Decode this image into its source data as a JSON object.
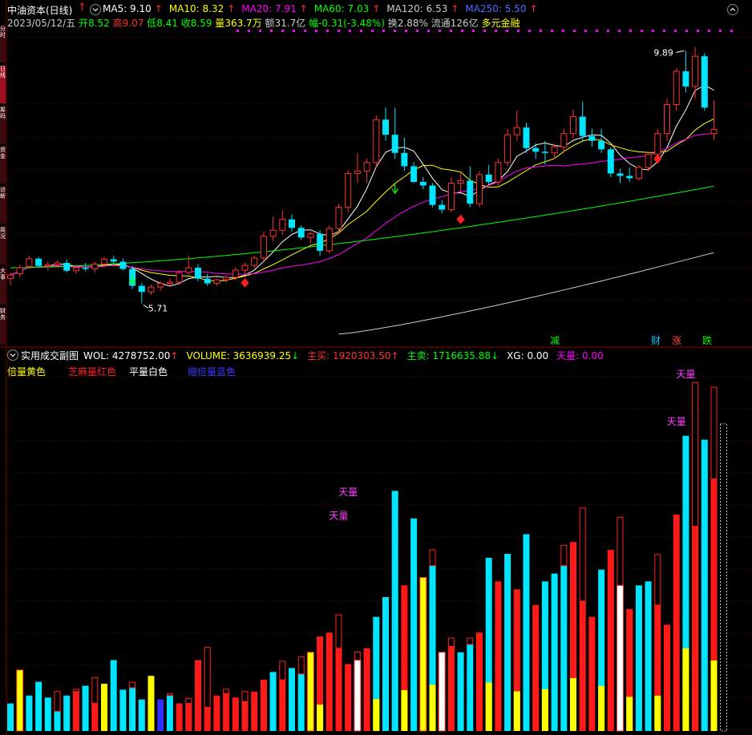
{
  "main_panel": {
    "stock_name": "中油资本(日线)",
    "ma_labels": [
      {
        "text": "MA5: 9.10",
        "color": "#ffffff"
      },
      {
        "text": "MA10: 8.32",
        "color": "#ffff00"
      },
      {
        "text": "MA20: 7.91",
        "color": "#ff00ff"
      },
      {
        "text": "MA60: 7.03",
        "color": "#00ff00"
      },
      {
        "text": "MA120: 6.53",
        "color": "#cccccc"
      },
      {
        "text": "MA250: 5.50",
        "color": "#4a6cff"
      }
    ],
    "info": {
      "date": "2023/05/12/五",
      "open_label": "开",
      "open": "8.52",
      "high_label": "高",
      "high": "9.07",
      "low_label": "低",
      "low": "8.41",
      "close_label": "收",
      "close": "8.59",
      "vol_label": "量",
      "vol": "363.7万",
      "amount_label": "额",
      "amount": "31.7亿",
      "change_label": "幅",
      "change": "-0.31(-3.48%)",
      "turnover_label": "换",
      "turnover": "2.88%",
      "float_label": "流通",
      "float": "126亿",
      "sector": "多元金融"
    },
    "high_mark": "9.89",
    "low_mark": "5.71",
    "markers": [
      {
        "text": "减",
        "color": "#00ff00"
      },
      {
        "text": "财",
        "color": "#00c8ff"
      },
      {
        "text": "涨",
        "color": "#ff4040"
      },
      {
        "text": "跌",
        "color": "#00ff00"
      }
    ]
  },
  "sub_panel": {
    "title": "实用成交副图",
    "stats": [
      {
        "text": "WOL: 4278752.00",
        "color": "#ffffff",
        "arrow": "↑",
        "arrow_color": "#ff3030"
      },
      {
        "text": "VOLUME: 3636939.25",
        "color": "#ffff00",
        "arrow": "↓",
        "arrow_color": "#00ff00"
      },
      {
        "text": "主买: 1920303.50",
        "color": "#ff3030",
        "arrow": "↑",
        "arrow_color": "#ff3030"
      },
      {
        "text": "主卖: 1716635.88",
        "color": "#00ff00",
        "arrow": "↓",
        "arrow_color": "#00ff00"
      },
      {
        "text": "XG: 0.00",
        "color": "#ffffff",
        "arrow": "",
        "arrow_color": "#ffffff"
      },
      {
        "text": "天量: 0.00",
        "color": "#ff00ff",
        "arrow": "",
        "arrow_color": "#ffffff"
      }
    ],
    "legend": [
      {
        "text": "倍量黄色",
        "color": "#ffff00"
      },
      {
        "text": "芝麻量红色",
        "color": "#ff2020"
      },
      {
        "text": "平量白色",
        "color": "#ffffff"
      },
      {
        "text": "缩倍量蓝色",
        "color": "#3a3aff"
      }
    ],
    "tianliang_label": "天量"
  },
  "side_tabs": [
    "分时",
    "日线",
    "筹码",
    "资金",
    "诊断",
    "简况",
    "大事",
    "财务"
  ],
  "chart_data": {
    "type": "candlestick",
    "price_range": [
      5.0,
      10.2
    ],
    "days": 76,
    "candles": [
      {
        "o": 6.12,
        "h": 6.22,
        "l": 6.0,
        "c": 6.18
      },
      {
        "o": 6.2,
        "h": 6.35,
        "l": 6.15,
        "c": 6.3
      },
      {
        "o": 6.32,
        "h": 6.5,
        "l": 6.28,
        "c": 6.45
      },
      {
        "o": 6.45,
        "h": 6.48,
        "l": 6.3,
        "c": 6.33
      },
      {
        "o": 6.33,
        "h": 6.4,
        "l": 6.25,
        "c": 6.35
      },
      {
        "o": 6.35,
        "h": 6.42,
        "l": 6.3,
        "c": 6.38
      },
      {
        "o": 6.38,
        "h": 6.44,
        "l": 6.22,
        "c": 6.25
      },
      {
        "o": 6.25,
        "h": 6.35,
        "l": 6.2,
        "c": 6.3
      },
      {
        "o": 6.3,
        "h": 6.38,
        "l": 6.24,
        "c": 6.28
      },
      {
        "o": 6.28,
        "h": 6.4,
        "l": 6.22,
        "c": 6.36
      },
      {
        "o": 6.36,
        "h": 6.48,
        "l": 6.3,
        "c": 6.44
      },
      {
        "o": 6.44,
        "h": 6.5,
        "l": 6.36,
        "c": 6.4
      },
      {
        "o": 6.4,
        "h": 6.45,
        "l": 6.25,
        "c": 6.28
      },
      {
        "o": 6.28,
        "h": 6.33,
        "l": 5.95,
        "c": 6.0
      },
      {
        "o": 6.0,
        "h": 6.05,
        "l": 5.71,
        "c": 5.9
      },
      {
        "o": 5.9,
        "h": 6.02,
        "l": 5.85,
        "c": 5.98
      },
      {
        "o": 5.98,
        "h": 6.08,
        "l": 5.92,
        "c": 6.04
      },
      {
        "o": 6.04,
        "h": 6.12,
        "l": 5.98,
        "c": 6.06
      },
      {
        "o": 6.06,
        "h": 6.26,
        "l": 6.02,
        "c": 6.22
      },
      {
        "o": 6.22,
        "h": 6.5,
        "l": 6.18,
        "c": 6.3
      },
      {
        "o": 6.3,
        "h": 6.36,
        "l": 6.08,
        "c": 6.12
      },
      {
        "o": 6.12,
        "h": 6.2,
        "l": 6.0,
        "c": 6.04
      },
      {
        "o": 6.04,
        "h": 6.12,
        "l": 6.0,
        "c": 6.1
      },
      {
        "o": 6.1,
        "h": 6.18,
        "l": 6.05,
        "c": 6.14
      },
      {
        "o": 6.14,
        "h": 6.3,
        "l": 6.1,
        "c": 6.26
      },
      {
        "o": 6.26,
        "h": 6.38,
        "l": 6.2,
        "c": 6.34
      },
      {
        "o": 6.34,
        "h": 6.5,
        "l": 6.3,
        "c": 6.46
      },
      {
        "o": 6.46,
        "h": 6.9,
        "l": 6.4,
        "c": 6.82
      },
      {
        "o": 6.82,
        "h": 7.15,
        "l": 6.74,
        "c": 6.92
      },
      {
        "o": 6.92,
        "h": 7.25,
        "l": 6.85,
        "c": 7.1
      },
      {
        "o": 7.1,
        "h": 7.18,
        "l": 6.9,
        "c": 6.96
      },
      {
        "o": 6.96,
        "h": 7.0,
        "l": 6.76,
        "c": 6.8
      },
      {
        "o": 6.8,
        "h": 6.9,
        "l": 6.7,
        "c": 6.86
      },
      {
        "o": 6.86,
        "h": 6.92,
        "l": 6.5,
        "c": 6.58
      },
      {
        "o": 6.58,
        "h": 7.0,
        "l": 6.54,
        "c": 6.95
      },
      {
        "o": 6.95,
        "h": 7.36,
        "l": 6.88,
        "c": 7.3
      },
      {
        "o": 7.3,
        "h": 7.92,
        "l": 7.22,
        "c": 7.86
      },
      {
        "o": 7.86,
        "h": 8.2,
        "l": 7.7,
        "c": 7.9
      },
      {
        "o": 7.9,
        "h": 8.1,
        "l": 7.7,
        "c": 8.04
      },
      {
        "o": 8.04,
        "h": 8.82,
        "l": 7.96,
        "c": 8.75
      },
      {
        "o": 8.75,
        "h": 8.95,
        "l": 8.4,
        "c": 8.5
      },
      {
        "o": 8.5,
        "h": 8.95,
        "l": 8.1,
        "c": 8.2
      },
      {
        "o": 8.2,
        "h": 8.45,
        "l": 7.9,
        "c": 7.98
      },
      {
        "o": 7.98,
        "h": 8.05,
        "l": 7.7,
        "c": 7.72
      },
      {
        "o": 7.72,
        "h": 7.8,
        "l": 7.6,
        "c": 7.66
      },
      {
        "o": 7.66,
        "h": 7.7,
        "l": 7.3,
        "c": 7.34
      },
      {
        "o": 7.34,
        "h": 7.42,
        "l": 7.2,
        "c": 7.26
      },
      {
        "o": 7.26,
        "h": 7.8,
        "l": 7.22,
        "c": 7.7
      },
      {
        "o": 7.7,
        "h": 7.86,
        "l": 7.55,
        "c": 7.74
      },
      {
        "o": 7.74,
        "h": 7.98,
        "l": 7.3,
        "c": 7.36
      },
      {
        "o": 7.36,
        "h": 7.9,
        "l": 7.3,
        "c": 7.84
      },
      {
        "o": 7.84,
        "h": 8.0,
        "l": 7.68,
        "c": 7.72
      },
      {
        "o": 7.72,
        "h": 8.1,
        "l": 7.66,
        "c": 8.04
      },
      {
        "o": 8.04,
        "h": 8.6,
        "l": 7.98,
        "c": 8.5
      },
      {
        "o": 8.5,
        "h": 8.9,
        "l": 8.4,
        "c": 8.62
      },
      {
        "o": 8.62,
        "h": 8.7,
        "l": 8.2,
        "c": 8.28
      },
      {
        "o": 8.28,
        "h": 8.36,
        "l": 8.1,
        "c": 8.22
      },
      {
        "o": 8.22,
        "h": 8.4,
        "l": 8.0,
        "c": 8.2
      },
      {
        "o": 8.2,
        "h": 8.35,
        "l": 8.1,
        "c": 8.3
      },
      {
        "o": 8.3,
        "h": 8.6,
        "l": 8.2,
        "c": 8.52
      },
      {
        "o": 8.52,
        "h": 8.92,
        "l": 8.44,
        "c": 8.8
      },
      {
        "o": 8.8,
        "h": 9.05,
        "l": 8.4,
        "c": 8.48
      },
      {
        "o": 8.48,
        "h": 8.6,
        "l": 8.3,
        "c": 8.4
      },
      {
        "o": 8.4,
        "h": 8.6,
        "l": 8.2,
        "c": 8.26
      },
      {
        "o": 8.26,
        "h": 8.3,
        "l": 7.8,
        "c": 7.86
      },
      {
        "o": 7.86,
        "h": 7.94,
        "l": 7.7,
        "c": 7.82
      },
      {
        "o": 7.82,
        "h": 7.96,
        "l": 7.72,
        "c": 7.78
      },
      {
        "o": 7.78,
        "h": 8.0,
        "l": 7.74,
        "c": 7.96
      },
      {
        "o": 7.96,
        "h": 8.22,
        "l": 7.9,
        "c": 8.18
      },
      {
        "o": 8.18,
        "h": 8.6,
        "l": 8.1,
        "c": 8.52
      },
      {
        "o": 8.52,
        "h": 9.1,
        "l": 8.4,
        "c": 9.0
      },
      {
        "o": 9.0,
        "h": 9.6,
        "l": 8.9,
        "c": 9.55
      },
      {
        "o": 9.55,
        "h": 9.89,
        "l": 9.2,
        "c": 9.3
      },
      {
        "o": 9.3,
        "h": 9.95,
        "l": 9.1,
        "c": 9.8
      },
      {
        "o": 9.8,
        "h": 9.85,
        "l": 8.9,
        "c": 8.95
      },
      {
        "o": 8.52,
        "h": 9.07,
        "l": 8.41,
        "c": 8.59
      }
    ],
    "volume_range": [
      0,
      9000000
    ],
    "volumes": [
      700000,
      1550000,
      900000,
      1250000,
      850000,
      500000,
      900000,
      1000000,
      1150000,
      700000,
      1200000,
      1800000,
      1050000,
      1100000,
      800000,
      1400000,
      800000,
      900000,
      700000,
      700000,
      1800000,
      600000,
      900000,
      950000,
      850000,
      750000,
      1000000,
      1300000,
      1500000,
      1300000,
      1600000,
      1450000,
      2000000,
      2400000,
      2500000,
      2100000,
      1700000,
      1800000,
      2100000,
      2900000,
      3400000,
      6100000,
      3700000,
      5400000,
      3900000,
      4200000,
      2000000,
      2150000,
      2000000,
      2200000,
      2500000,
      4400000,
      3800000,
      4500000,
      3600000,
      5000000,
      3200000,
      3800000,
      4000000,
      4200000,
      4800000,
      3300000,
      2900000,
      4100000,
      4600000,
      3700000,
      3100000,
      3700000,
      3800000,
      3200000,
      2700000,
      5500000,
      7500000,
      5200000,
      7400000,
      6400000
    ],
    "volume_colors": [
      "cyan",
      "yellow",
      "cyan",
      "cyan",
      "cyan",
      "cyan",
      "cyan",
      "red",
      "cyan",
      "red",
      "yellow",
      "cyan",
      "cyan",
      "cyan",
      "cyan",
      "yellow",
      "blue",
      "cyan",
      "red",
      "red",
      "red",
      "red",
      "red",
      "red",
      "red",
      "red",
      "red",
      "red",
      "cyan",
      "red",
      "cyan",
      "cyan",
      "yellow",
      "red",
      "red",
      "red",
      "red",
      "white",
      "red",
      "cyan",
      "cyan",
      "cyan",
      "red",
      "cyan",
      "yellow",
      "cyan",
      "white",
      "red",
      "cyan",
      "cyan",
      "red",
      "cyan",
      "red",
      "cyan",
      "red",
      "cyan",
      "red",
      "cyan",
      "cyan",
      "cyan",
      "red",
      "red",
      "red",
      "cyan",
      "red",
      "white",
      "red",
      "cyan",
      "cyan",
      "red",
      "red",
      "red",
      "cyan",
      "red",
      "cyan",
      "red"
    ],
    "last_volume_outline": 7800000
  }
}
